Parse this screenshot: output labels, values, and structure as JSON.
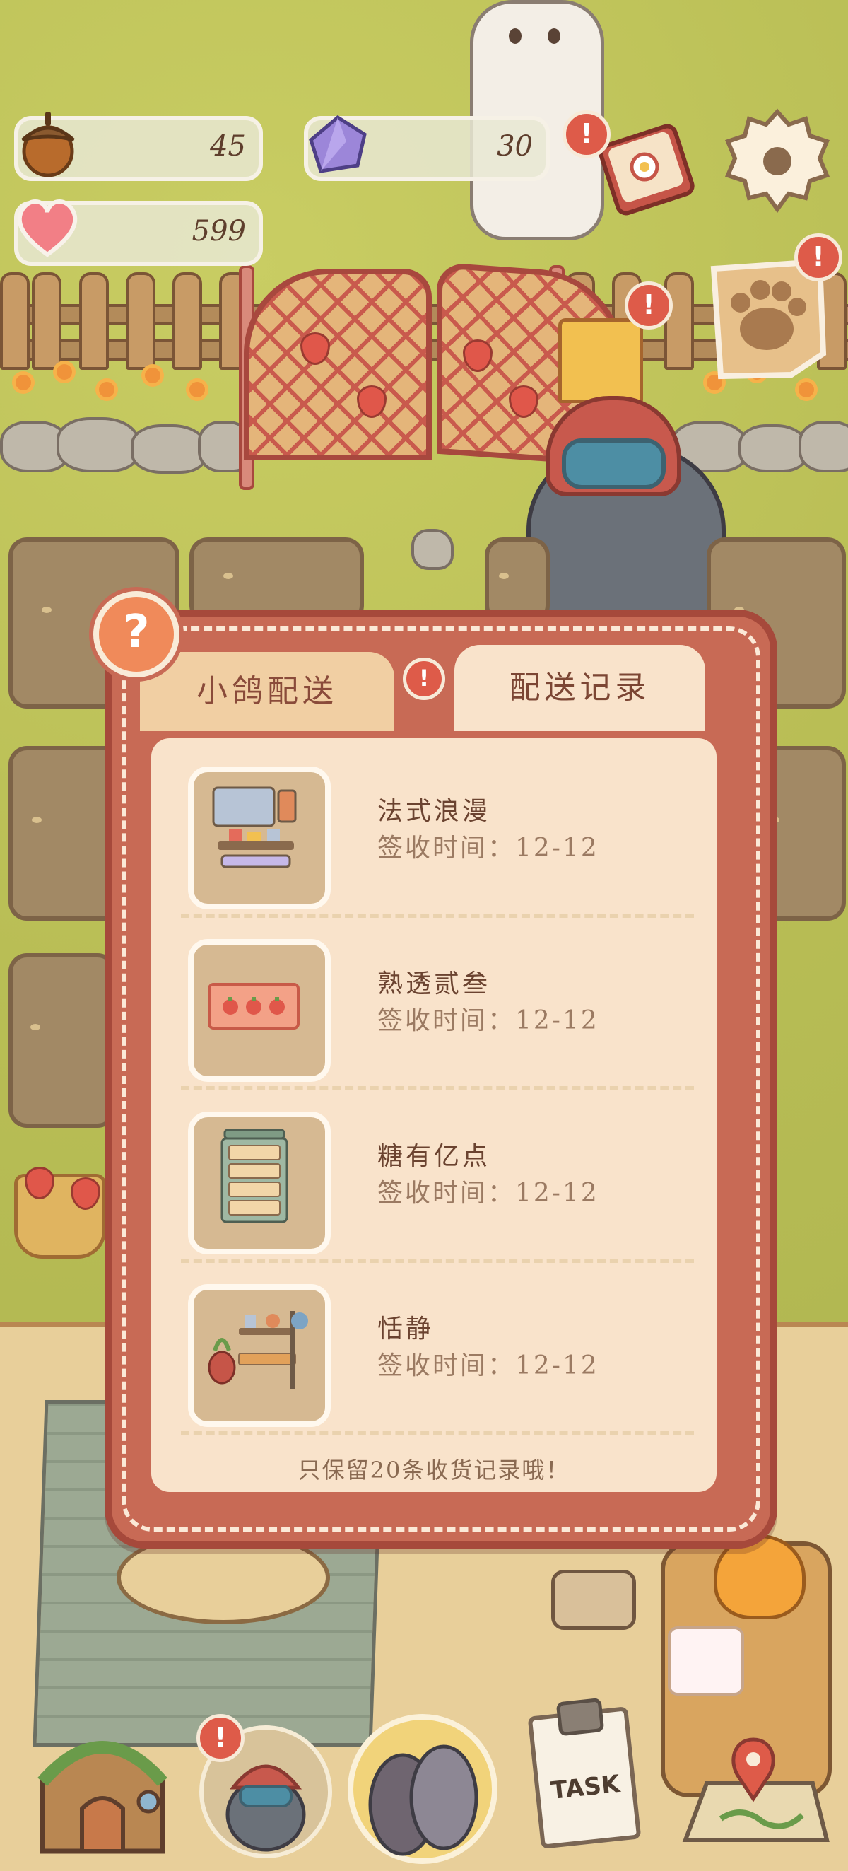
{
  "hud": {
    "acorns": "45",
    "gems": "30",
    "hearts": "599",
    "alert_mark": "!"
  },
  "panel": {
    "help_mark": "?",
    "tabs": [
      {
        "label": "小鸽配送",
        "active": false
      },
      {
        "label": "配送记录",
        "active": true
      }
    ],
    "records": [
      {
        "title": "法式浪漫",
        "time": "签收时间：12-12",
        "icon": "furniture-set-icon"
      },
      {
        "title": "熟透贰叁",
        "time": "签收时间：12-12",
        "icon": "strawberry-rug-icon"
      },
      {
        "title": "糖有亿点",
        "time": "签收时间：12-12",
        "icon": "drawer-cabinet-icon"
      },
      {
        "title": "恬静",
        "time": "签收时间：12-12",
        "icon": "garden-shelf-icon"
      }
    ],
    "footer_note": "只保留20条收货记录哦！"
  },
  "bottom_nav": {
    "task_label": "TASK"
  },
  "colors": {
    "panel_border": "#a6493b",
    "panel_fill": "#c86a55",
    "list_bg": "#f9e3cb",
    "badge_red": "#de5b49",
    "grass": "#b9be55"
  }
}
